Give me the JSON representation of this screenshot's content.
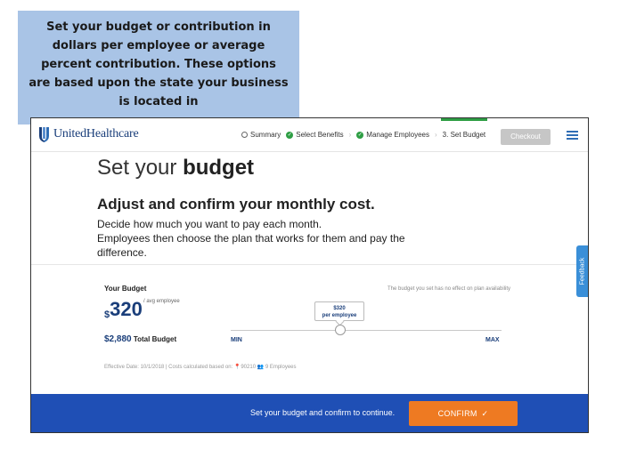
{
  "callout": {
    "text": "Set your budget or contribution in dollars per employee or average percent contribution. These options are based upon the state your business is located in"
  },
  "header": {
    "brand": "UnitedHealthcare",
    "nav": [
      {
        "label": "Summary",
        "state": "pending"
      },
      {
        "label": "Select Benefits",
        "state": "done"
      },
      {
        "label": "Manage Employees",
        "state": "done"
      },
      {
        "label": "3. Set Budget",
        "state": "active"
      }
    ],
    "checkout_label": "Checkout",
    "menu_icon": "hamburger-icon"
  },
  "main": {
    "title_prefix": "Set your",
    "title_bold": "budget",
    "section_title": "Adjust and confirm your monthly cost.",
    "desc_line1": "Decide how much you want to pay each month.",
    "desc_line2": "Employees then choose the plan that works for them and pay the difference."
  },
  "budget": {
    "label": "Your Budget",
    "currency": "$",
    "amount": "320",
    "per_note": "/ avg employee",
    "total_amount": "$2,880",
    "total_label": "Total Budget",
    "notice": "The budget you set has no effect on plan availability",
    "tooltip_value": "$320",
    "tooltip_caption": "per employee",
    "min_label": "MIN",
    "max_label": "MAX",
    "meta": "Effective Date: 10/1/2018  |  Costs calculated based on: 📍90210   👥 9 Employees"
  },
  "feedback_label": "Feedback",
  "footer": {
    "text": "Set your budget and confirm to continue.",
    "confirm_label": "CONFIRM"
  },
  "colors": {
    "brand_blue": "#1a3e7a",
    "footer_blue": "#1f4fb5",
    "confirm_orange": "#ee7a22",
    "callout_blue": "#a9c4e6",
    "done_green": "#2e9e44"
  }
}
